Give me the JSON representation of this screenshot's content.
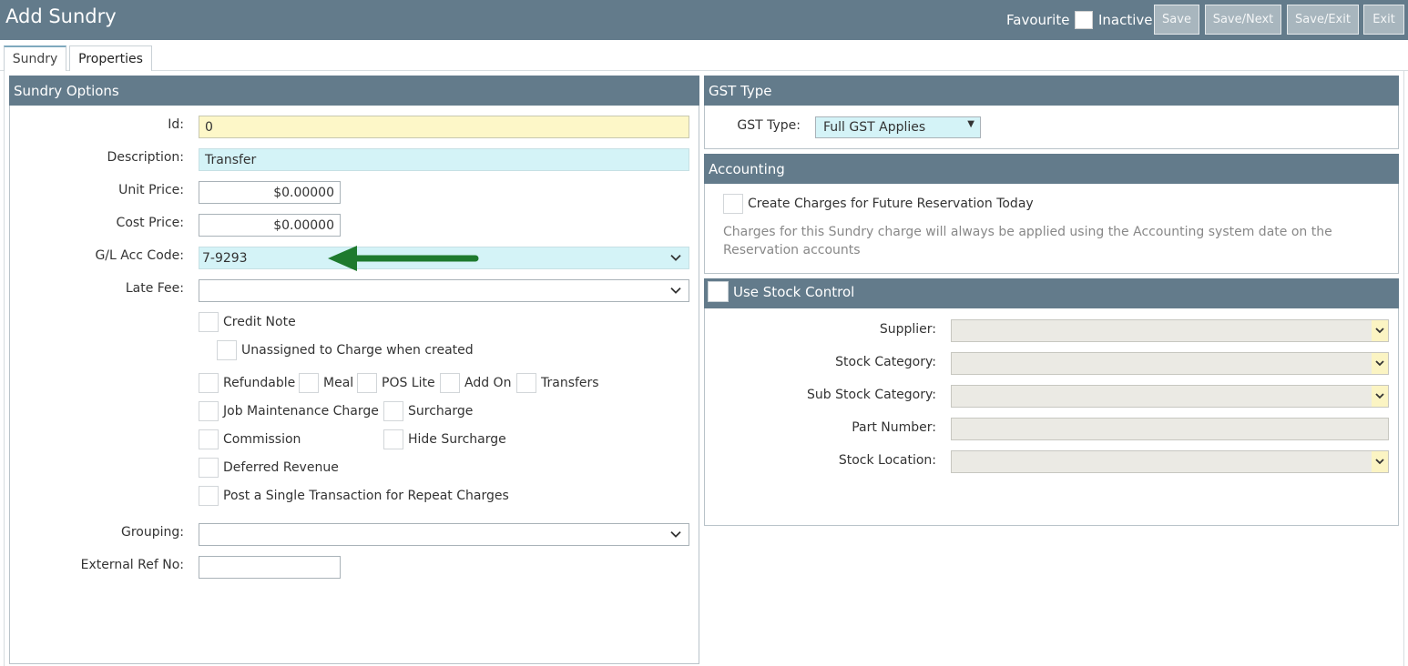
{
  "header": {
    "title": "Add Sundry",
    "favourite_label": "Favourite",
    "inactive_label": "Inactive",
    "buttons": {
      "save": "Save",
      "save_next": "Save/Next",
      "save_exit": "Save/Exit",
      "exit": "Exit"
    }
  },
  "tabs": [
    {
      "label": "Sundry"
    },
    {
      "label": "Properties"
    }
  ],
  "sundry_options": {
    "title": "Sundry Options",
    "id": {
      "label": "Id:",
      "value": "0"
    },
    "description": {
      "label": "Description:",
      "value": "Transfer"
    },
    "unit_price": {
      "label": "Unit Price:",
      "value": "$0.00000"
    },
    "cost_price": {
      "label": "Cost Price:",
      "value": "$0.00000"
    },
    "gl_acc_code": {
      "label": "G/L Acc Code:",
      "value": "7-9293"
    },
    "late_fee": {
      "label": "Late Fee:",
      "value": ""
    },
    "checkboxes": {
      "credit_note": "Credit Note",
      "unassigned": "Unassigned to Charge when created",
      "refundable": "Refundable",
      "meal": "Meal",
      "pos_lite": "POS Lite",
      "add_on": "Add On",
      "transfers": "Transfers",
      "job_maintenance": "Job Maintenance Charge",
      "surcharge": "Surcharge",
      "commission": "Commission",
      "hide_surcharge": "Hide Surcharge",
      "deferred_revenue": "Deferred Revenue",
      "single_transaction": "Post a Single Transaction for Repeat Charges"
    },
    "grouping": {
      "label": "Grouping:",
      "value": ""
    },
    "external_ref": {
      "label": "External Ref No:",
      "value": ""
    }
  },
  "gst": {
    "title": "GST Type",
    "label": "GST Type:",
    "value": "Full GST Applies"
  },
  "accounting": {
    "title": "Accounting",
    "checkbox_label": "Create Charges for Future Reservation Today",
    "note": "Charges for this Sundry charge will always be applied using the Accounting system date on the Reservation accounts"
  },
  "stock": {
    "title": "Use Stock Control",
    "supplier": "Supplier:",
    "stock_category": "Stock Category:",
    "sub_stock_category": "Sub Stock Category:",
    "part_number": "Part Number:",
    "stock_location": "Stock Location:"
  },
  "colors": {
    "header": "#637b8b",
    "arrow": "#1e7a2e",
    "yellow_field": "#fdf7c8",
    "cyan_field": "#d4f3f7"
  },
  "icons": {
    "dropdown": "chevron-down-icon",
    "annotation": "green-arrow-icon"
  }
}
